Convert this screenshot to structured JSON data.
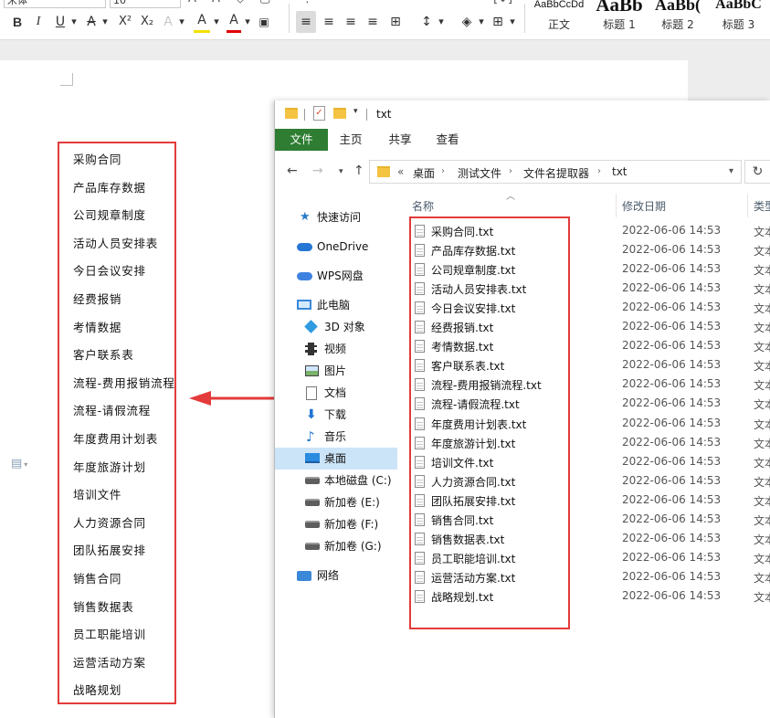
{
  "ribbon": {
    "font_name": "宋体",
    "font_size": "10",
    "format_buttons": [
      "B",
      "I",
      "U",
      "A",
      "X²",
      "X₂",
      "A",
      "A",
      "A"
    ],
    "styles": [
      {
        "sample": "AaBbCcDd",
        "label": "正文"
      },
      {
        "sample": "AaBb",
        "label": "标题 1"
      },
      {
        "sample": "AaBb(",
        "label": "标题 2"
      },
      {
        "sample": "AaBbC",
        "label": "标题 3"
      }
    ]
  },
  "document": {
    "items": [
      "采购合同",
      "产品库存数据",
      "公司规章制度",
      "活动人员安排表",
      "今日会议安排",
      "经费报销",
      "考情数据",
      "客户联系表",
      "流程-费用报销流程",
      "流程-请假流程",
      "年度费用计划表",
      "年度旅游计划",
      "培训文件",
      "人力资源合同",
      "团队拓展安排",
      "销售合同",
      "销售数据表",
      "员工职能培训",
      "运营活动方案",
      "战略规划"
    ]
  },
  "explorer": {
    "title": "txt",
    "tabs": [
      {
        "label": "文件",
        "active": true
      },
      {
        "label": "主页"
      },
      {
        "label": "共享"
      },
      {
        "label": "查看"
      }
    ],
    "breadcrumb": {
      "overflow": "«",
      "parts": [
        "桌面",
        "测试文件",
        "文件名提取器",
        "txt"
      ]
    },
    "nav": [
      {
        "label": "快速访问",
        "icon": "star-icon"
      },
      {
        "label": "OneDrive",
        "icon": "cloud-icon"
      },
      {
        "label": "WPS网盘",
        "icon": "cloud-icon"
      },
      {
        "label": "此电脑",
        "icon": "computer-icon"
      },
      {
        "label": "3D 对象",
        "icon": "cube-icon"
      },
      {
        "label": "视频",
        "icon": "video-icon"
      },
      {
        "label": "图片",
        "icon": "picture-icon"
      },
      {
        "label": "文档",
        "icon": "document-icon"
      },
      {
        "label": "下载",
        "icon": "download-icon"
      },
      {
        "label": "音乐",
        "icon": "music-icon"
      },
      {
        "label": "桌面",
        "icon": "desktop-icon",
        "selected": true
      },
      {
        "label": "本地磁盘 (C:)",
        "icon": "drive-icon"
      },
      {
        "label": "新加卷 (E:)",
        "icon": "drive-icon"
      },
      {
        "label": "新加卷 (F:)",
        "icon": "drive-icon"
      },
      {
        "label": "新加卷 (G:)",
        "icon": "drive-icon"
      },
      {
        "label": "网络",
        "icon": "network-icon"
      }
    ],
    "columns": {
      "name": "名称",
      "date": "修改日期",
      "type": "类型"
    },
    "files": [
      {
        "name": "采购合同.txt",
        "date": "2022-06-06 14:53",
        "type": "文本"
      },
      {
        "name": "产品库存数据.txt",
        "date": "2022-06-06 14:53",
        "type": "文本"
      },
      {
        "name": "公司规章制度.txt",
        "date": "2022-06-06 14:53",
        "type": "文本"
      },
      {
        "name": "活动人员安排表.txt",
        "date": "2022-06-06 14:53",
        "type": "文本"
      },
      {
        "name": "今日会议安排.txt",
        "date": "2022-06-06 14:53",
        "type": "文本"
      },
      {
        "name": "经费报销.txt",
        "date": "2022-06-06 14:53",
        "type": "文本"
      },
      {
        "name": "考情数据.txt",
        "date": "2022-06-06 14:53",
        "type": "文本"
      },
      {
        "name": "客户联系表.txt",
        "date": "2022-06-06 14:53",
        "type": "文本"
      },
      {
        "name": "流程-费用报销流程.txt",
        "date": "2022-06-06 14:53",
        "type": "文本"
      },
      {
        "name": "流程-请假流程.txt",
        "date": "2022-06-06 14:53",
        "type": "文本"
      },
      {
        "name": "年度费用计划表.txt",
        "date": "2022-06-06 14:53",
        "type": "文本"
      },
      {
        "name": "年度旅游计划.txt",
        "date": "2022-06-06 14:53",
        "type": "文本"
      },
      {
        "name": "培训文件.txt",
        "date": "2022-06-06 14:53",
        "type": "文本"
      },
      {
        "name": "人力资源合同.txt",
        "date": "2022-06-06 14:53",
        "type": "文本"
      },
      {
        "name": "团队拓展安排.txt",
        "date": "2022-06-06 14:53",
        "type": "文本"
      },
      {
        "name": "销售合同.txt",
        "date": "2022-06-06 14:53",
        "type": "文本"
      },
      {
        "name": "销售数据表.txt",
        "date": "2022-06-06 14:53",
        "type": "文本"
      },
      {
        "name": "员工职能培训.txt",
        "date": "2022-06-06 14:53",
        "type": "文本"
      },
      {
        "name": "运营活动方案.txt",
        "date": "2022-06-06 14:53",
        "type": "文本"
      },
      {
        "name": "战略规划.txt",
        "date": "2022-06-06 14:53",
        "type": "文本"
      }
    ]
  },
  "colors": {
    "highlight_red": "#e33a3a",
    "file_tab_green": "#2e7d32",
    "selected_nav": "#cce4f7"
  }
}
